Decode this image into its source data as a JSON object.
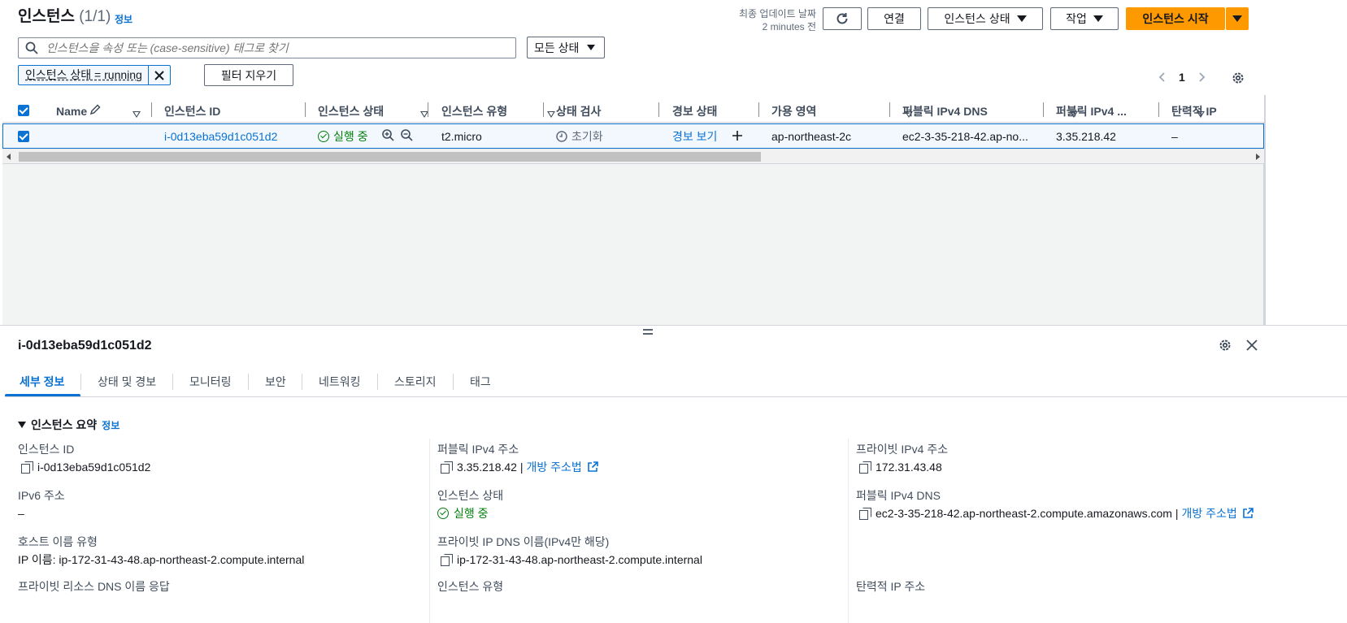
{
  "header": {
    "title": "인스턴스",
    "count": "(1/1)",
    "info_link": "정보",
    "last_updated_label": "최종 업데이트 날짜",
    "last_updated_value": "2 minutes 전",
    "connect_label": "연결",
    "instance_state_label": "인스턴스 상태",
    "actions_label": "작업",
    "launch_label": "인스턴스 시작"
  },
  "filter": {
    "search_placeholder": "인스턴스을 속성 또는 (case-sensitive) 태그로 찾기",
    "state_select": "모든 상태",
    "token": "인스턴스 상태 = running",
    "clear_label": "필터 지우기",
    "page_number": "1"
  },
  "table": {
    "columns": [
      "Name",
      "인스턴스 ID",
      "인스턴스 상태",
      "인스턴스 유형",
      "상태 검사",
      "경보 상태",
      "가용 영역",
      "퍼블릭 IPv4 DNS",
      "퍼블릭 IPv4 ...",
      "탄력적 IP"
    ],
    "row": {
      "name": "",
      "instance_id": "i-0d13eba59d1c051d2",
      "state": "실행 중",
      "type": "t2.micro",
      "status_check": "초기화",
      "alarm": "경보 보기",
      "az": "ap-northeast-2c",
      "dns": "ec2-3-35-218-42.ap-no...",
      "ipv4": "3.35.218.42",
      "elastic_ip": "–"
    }
  },
  "detail": {
    "title": "i-0d13eba59d1c051d2",
    "tabs": [
      "세부 정보",
      "상태 및 경보",
      "모니터링",
      "보안",
      "네트워킹",
      "스토리지",
      "태그"
    ],
    "section_title": "인스턴스 요약",
    "section_info": "정보",
    "fields": {
      "instance_id_label": "인스턴스 ID",
      "instance_id_value": "i-0d13eba59d1c051d2",
      "public_ipv4_label": "퍼블릭 IPv4 주소",
      "public_ipv4_value": "3.35.218.42 |",
      "open_address": "개방 주소법",
      "private_ipv4_label": "프라이빗 IPv4 주소",
      "private_ipv4_value": "172.31.43.48",
      "ipv6_label": "IPv6 주소",
      "ipv6_value": "–",
      "state_label": "인스턴스 상태",
      "state_value": "실행 중",
      "public_dns_label": "퍼블릭 IPv4 DNS",
      "public_dns_value": "ec2-3-35-218-42.ap-northeast-2.compute.amazonaws.com |",
      "hostname_type_label": "호스트 이름 유형",
      "hostname_type_value": "IP 이름: ip-172-31-43-48.ap-northeast-2.compute.internal",
      "private_dns_label": "프라이빗 IP DNS 이름(IPv4만 해당)",
      "private_dns_value": "ip-172-31-43-48.ap-northeast-2.compute.internal",
      "private_resource_dns_label": "프라이빗 리소스 DNS 이름 응답",
      "instance_type_label": "인스턴스 유형",
      "elastic_ip_label": "탄력적 IP 주소"
    }
  },
  "colors": {
    "accent": "#0972d3",
    "primary": "#ff9900",
    "success": "#037f0c"
  }
}
